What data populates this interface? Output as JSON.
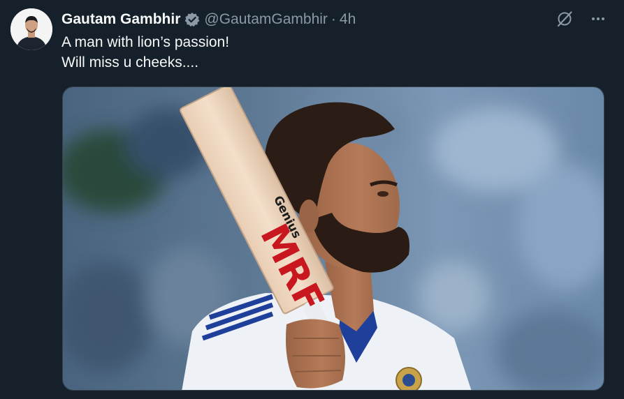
{
  "tweet": {
    "author_name": "Gautam Gambhir",
    "handle": "@GautamGambhir",
    "separator": "·",
    "timestamp": "4h",
    "text_line1": "A man with lion’s passion!",
    "text_line2": "Will miss u cheeks....",
    "bat_brand": "MRF",
    "bat_model": "Genius"
  },
  "icons": {
    "verified": "verified-badge-icon",
    "grok": "grok-icon",
    "more": "more-options-icon"
  },
  "colors": {
    "background": "#15202b",
    "primary_text": "#f7f9f9",
    "secondary_text": "#8b98a5",
    "verified_badge": "#8b98a5"
  }
}
